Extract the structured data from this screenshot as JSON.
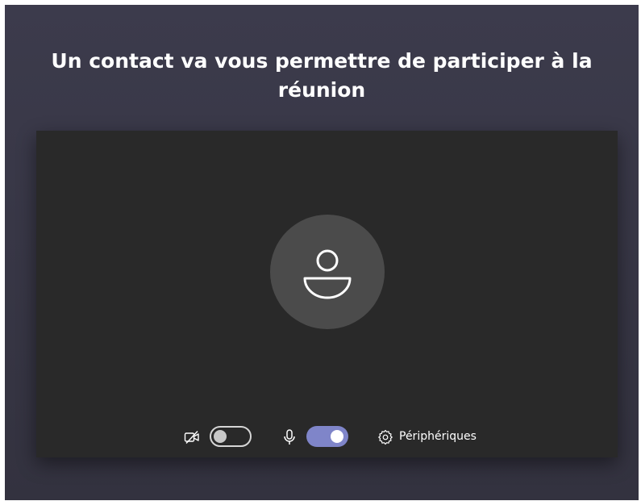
{
  "heading": "Un contact va vous permettre de participer à la réunion",
  "preview": {
    "avatar_icon": "person-icon"
  },
  "controls": {
    "camera": {
      "icon": "camera-off-icon",
      "state": "off"
    },
    "microphone": {
      "icon": "microphone-icon",
      "state": "on"
    },
    "devices": {
      "icon": "gear-icon",
      "label": "Périphériques"
    }
  },
  "colors": {
    "background": "#3a3948",
    "preview": "#292929",
    "avatar": "#4b4b4b",
    "toggle_on": "#7f85c9"
  }
}
